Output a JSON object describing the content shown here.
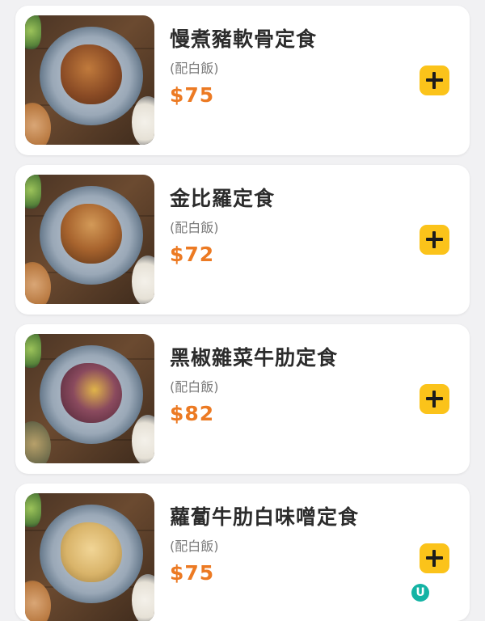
{
  "menu": {
    "items": [
      {
        "name": "慢煮豬軟骨定食",
        "note": "(配白飯)",
        "price": "$75",
        "food_color": "#8a4b25",
        "add_icon": "plus-icon"
      },
      {
        "name": "金比羅定食",
        "note": "(配白飯)",
        "price": "$72",
        "food_color": "#a8642e",
        "add_icon": "plus-icon"
      },
      {
        "name": "黑椒雜菜牛肋定食",
        "note": "(配白飯)",
        "price": "$82",
        "food_color": "#6e3b4e",
        "add_icon": "plus-icon"
      },
      {
        "name": "蘿蔔牛肋白味噌定食",
        "note": "(配白飯)",
        "price": "$75",
        "food_color": "#d9b46a",
        "add_icon": "plus-icon"
      }
    ]
  },
  "watermark": {
    "letter": "U",
    "icon": "brand-logo-icon",
    "color": "#14b3a4"
  },
  "colors": {
    "accent_price": "#ec7a23",
    "add_button": "#fbc31a",
    "background": "#f1f1f3"
  }
}
